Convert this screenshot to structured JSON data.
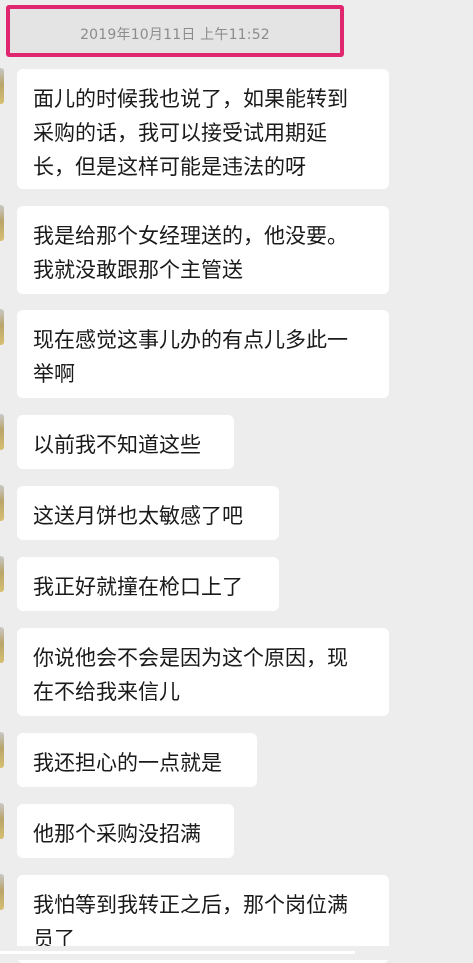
{
  "chat": {
    "timestamp": "2019年10月11日 上午11:52",
    "messages": [
      "面儿的时候我也说了，如果能转到\n采购的话，我可以接受试用期延\n长，但是这样可能是违法的呀",
      "我是给那个女经理送的，他没要。\n我就没敢跟那个主管送",
      "现在感觉这事儿办的有点儿多此一\n举啊",
      "以前我不知道这些",
      "这送月饼也太敏感了吧",
      "我正好就撞在枪口上了",
      "你说他会不会是因为这个原因，现\n在不给我来信儿",
      "我还担心的一点就是",
      "他那个采购没招满",
      "我怕等到我转正之后，那个岗位满\n员了"
    ]
  }
}
